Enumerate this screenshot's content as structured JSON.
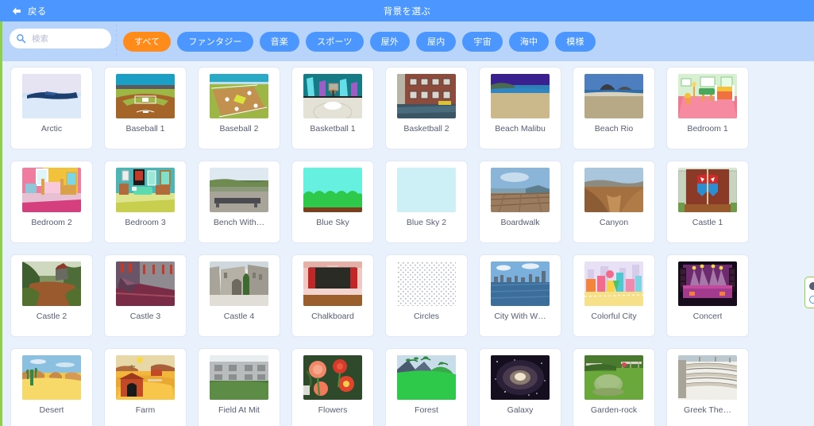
{
  "header": {
    "back_label": "戻る",
    "back_icon": "arrow-left-icon",
    "title": "背景を選ぶ",
    "bg_color": "#4c97ff"
  },
  "filter_bar": {
    "bg_color": "#b9d4fb",
    "search": {
      "icon": "search-icon",
      "placeholder": "検索",
      "value": ""
    },
    "tags": [
      {
        "label": "すべて",
        "active": true
      },
      {
        "label": "ファンタジー",
        "active": false
      },
      {
        "label": "音楽",
        "active": false
      },
      {
        "label": "スポーツ",
        "active": false
      },
      {
        "label": "屋外",
        "active": false
      },
      {
        "label": "屋内",
        "active": false
      },
      {
        "label": "宇宙",
        "active": false
      },
      {
        "label": "海中",
        "active": false
      },
      {
        "label": "模様",
        "active": false
      }
    ],
    "active_tag_color": "#ff8c1a",
    "tag_color": "#4c97ff"
  },
  "gallery": {
    "columns": 8,
    "items": [
      {
        "label": "Arctic",
        "art": "arctic"
      },
      {
        "label": "Baseball 1",
        "art": "baseball1"
      },
      {
        "label": "Baseball 2",
        "art": "baseball2"
      },
      {
        "label": "Basketball 1",
        "art": "basketball1"
      },
      {
        "label": "Basketball 2",
        "art": "basketball2"
      },
      {
        "label": "Beach Malibu",
        "art": "beachmalibu"
      },
      {
        "label": "Beach Rio",
        "art": "beachrio"
      },
      {
        "label": "Bedroom 1",
        "art": "bedroom1"
      },
      {
        "label": "Bedroom 2",
        "art": "bedroom2"
      },
      {
        "label": "Bedroom 3",
        "art": "bedroom3"
      },
      {
        "label": "Bench With…",
        "art": "bench"
      },
      {
        "label": "Blue Sky",
        "art": "bluesky"
      },
      {
        "label": "Blue Sky 2",
        "art": "bluesky2"
      },
      {
        "label": "Boardwalk",
        "art": "boardwalk"
      },
      {
        "label": "Canyon",
        "art": "canyon"
      },
      {
        "label": "Castle 1",
        "art": "castle1"
      },
      {
        "label": "Castle 2",
        "art": "castle2"
      },
      {
        "label": "Castle 3",
        "art": "castle3"
      },
      {
        "label": "Castle 4",
        "art": "castle4"
      },
      {
        "label": "Chalkboard",
        "art": "chalkboard"
      },
      {
        "label": "Circles",
        "art": "circles"
      },
      {
        "label": "City With W…",
        "art": "citywater"
      },
      {
        "label": "Colorful City",
        "art": "colorfulcity"
      },
      {
        "label": "Concert",
        "art": "concert"
      },
      {
        "label": "Desert",
        "art": "desert"
      },
      {
        "label": "Farm",
        "art": "farm"
      },
      {
        "label": "Field At Mit",
        "art": "fieldmit"
      },
      {
        "label": "Flowers",
        "art": "flowers"
      },
      {
        "label": "Forest",
        "art": "forest"
      },
      {
        "label": "Galaxy",
        "art": "galaxy"
      },
      {
        "label": "Garden-rock",
        "art": "gardenrock"
      },
      {
        "label": "Greek The…",
        "art": "greektheater"
      }
    ]
  },
  "edge_widget": {
    "icons": [
      "eye-icon",
      "circle-icon"
    ],
    "border_color": "#8ed04a"
  },
  "theme": {
    "page_bg": "#e9f1fc",
    "card_bg": "#ffffff",
    "label_color": "#575e75",
    "rail_color": "#8ed04a"
  }
}
